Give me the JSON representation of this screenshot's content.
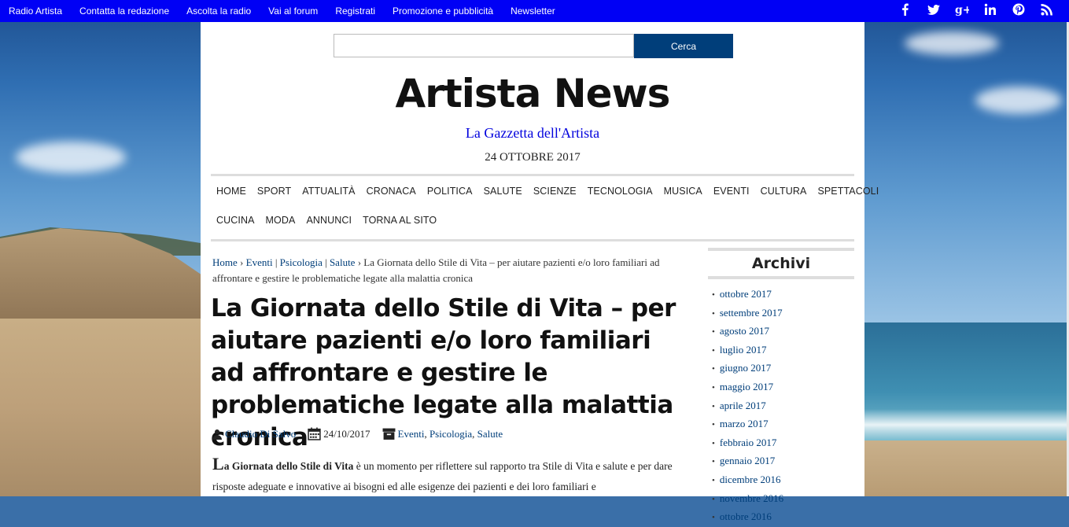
{
  "topbar": {
    "links": [
      "Radio Artista",
      "Contatta la redazione",
      "Ascolta la radio",
      "Vai al forum",
      "Registrati",
      "Promozione e pubblicità",
      "Newsletter"
    ],
    "social": [
      {
        "icon": "facebook-icon",
        "glyph": "f"
      },
      {
        "icon": "twitter-icon",
        "glyph": "t"
      },
      {
        "icon": "google-plus-icon",
        "glyph": "g+"
      },
      {
        "icon": "linkedin-icon",
        "glyph": "in"
      },
      {
        "icon": "pinterest-icon",
        "glyph": "p"
      },
      {
        "icon": "rss-icon",
        "glyph": "rss"
      }
    ]
  },
  "search": {
    "value": "",
    "button": "Cerca"
  },
  "site": {
    "title": "Artista News",
    "tagline": "La Gazzetta dell'Artista",
    "date": "24 OTTOBRE 2017"
  },
  "nav": {
    "row1": [
      "HOME",
      "SPORT",
      "ATTUALITÀ",
      "CRONACA",
      "POLITICA",
      "SALUTE",
      "SCIENZE",
      "TECNOLOGIA",
      "MUSICA",
      "EVENTI",
      "CULTURA",
      "SPETTACOLI"
    ],
    "row2": [
      "CUCINA",
      "MODA",
      "ANNUNCI",
      "TORNA AL SITO"
    ]
  },
  "breadcrumb": {
    "home": "Home",
    "sep1": "›",
    "cat1": "Eventi",
    "bar1": "|",
    "cat2": "Psicologia",
    "bar2": "|",
    "cat3": "Salute",
    "sep2": "›",
    "current": "La Giornata dello Stile di Vita – per aiutare pazienti e/o loro familiari ad affrontare e gestire le problematiche legate alla malattia cronica"
  },
  "article": {
    "title": "La Giornata dello Stile di Vita – per aiutare pazienti e/o loro familiari ad affrontare e gestire le problematiche legate alla malattia cronica",
    "author": "Claudio Di Salvo",
    "date": "24/10/2017",
    "categories": [
      "Eventi",
      "Psicologia",
      "Salute"
    ],
    "comma": ",",
    "lead_drop": "L",
    "lead_bold": "a Giornata dello Stile di Vita",
    "lead_text": " è un momento per riflettere sul rapporto tra Stile di Vita e salute e per dare risposte adeguate e innovative ai bisogni ed alle esigenze dei pazienti e dei loro familiari e"
  },
  "sidebar": {
    "title": "Archivi",
    "items": [
      "ottobre 2017",
      "settembre 2017",
      "agosto 2017",
      "luglio 2017",
      "giugno 2017",
      "maggio 2017",
      "aprile 2017",
      "marzo 2017",
      "febbraio 2017",
      "gennaio 2017",
      "dicembre 2016",
      "novembre 2016",
      "ottobre 2016"
    ]
  },
  "colors": {
    "topbar": "#0000f5",
    "button": "#003e7a",
    "link": "#003e7a",
    "tagline": "#0000dd"
  }
}
